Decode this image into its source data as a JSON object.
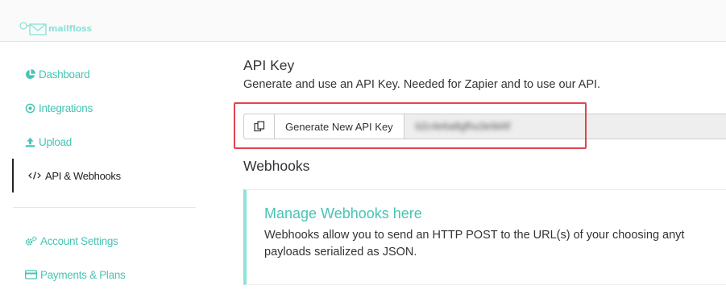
{
  "app": {
    "logo_text": "mailfloss"
  },
  "colors": {
    "accent": "#48c4b4",
    "accent_light": "#8fe3d8",
    "highlight": "#e0454f"
  },
  "sidebar": {
    "items": [
      {
        "label": "Dashboard",
        "icon": "pie-chart-icon"
      },
      {
        "label": "Integrations",
        "icon": "dot-circle-icon"
      },
      {
        "label": "Upload",
        "icon": "upload-icon"
      },
      {
        "label": "API & Webhooks",
        "icon": "code-icon",
        "active": true
      },
      {
        "label": "Account Settings",
        "icon": "cogs-icon"
      },
      {
        "label": "Payments & Plans",
        "icon": "credit-card-icon"
      }
    ]
  },
  "api_key": {
    "title": "API Key",
    "description": "Generate and use an API Key. Needed for Zapier and to use our API.",
    "generate_label": "Generate New API Key",
    "key_value": "b2c4e6a8gfhu3e9d4f"
  },
  "webhooks": {
    "title": "Webhooks",
    "link_label": "Manage Webhooks here",
    "description_line1": "Webhooks allow you to send an HTTP POST to the URL(s) of your choosing anyt",
    "description_line2": "payloads serialized as JSON."
  }
}
